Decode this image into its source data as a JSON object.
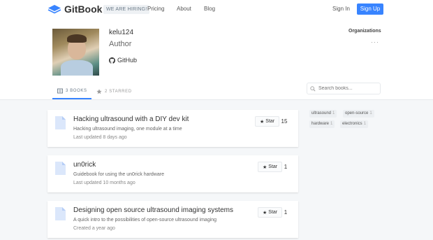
{
  "header": {
    "brand": "GitBook",
    "hiring": "WE ARE HIRING!",
    "nav": [
      "Pricing",
      "About",
      "Blog"
    ],
    "signin": "Sign In",
    "signup": "Sign Up"
  },
  "profile": {
    "username": "kelu124",
    "role": "Author",
    "github_label": "GitHub",
    "orgs_title": "Organizations",
    "orgs_more": "···"
  },
  "tabs": [
    {
      "label": "3 BOOKS",
      "active": true,
      "icon": "book-icon"
    },
    {
      "label": "2 STARRED",
      "active": false,
      "icon": "star-icon"
    }
  ],
  "search": {
    "placeholder": "Search books..."
  },
  "books": [
    {
      "title": "Hacking ultrasound with a DIY dev kit",
      "description": "Hacking ultrasound imaging, one module at a time",
      "updated": "Last updated 8 days ago",
      "star_label": "Star",
      "stars": "15"
    },
    {
      "title": "un0rick",
      "description": "Guidebook for using the un0rick hardware",
      "updated": "Last updated 10 months ago",
      "star_label": "Star",
      "stars": "1"
    },
    {
      "title": "Designing open source ultrasound imaging systems",
      "description": "A quick intro to the possibilities of open-source ultrasound imaging",
      "updated": "Created a year ago",
      "star_label": "Star",
      "stars": "1"
    }
  ],
  "tags": [
    {
      "name": "ultrasound",
      "count": "1"
    },
    {
      "name": "open-source",
      "count": "1"
    },
    {
      "name": "hardware",
      "count": "1"
    },
    {
      "name": "electronics",
      "count": "1"
    }
  ],
  "colors": {
    "accent": "#3884ff",
    "background": "#f5f7f9"
  }
}
